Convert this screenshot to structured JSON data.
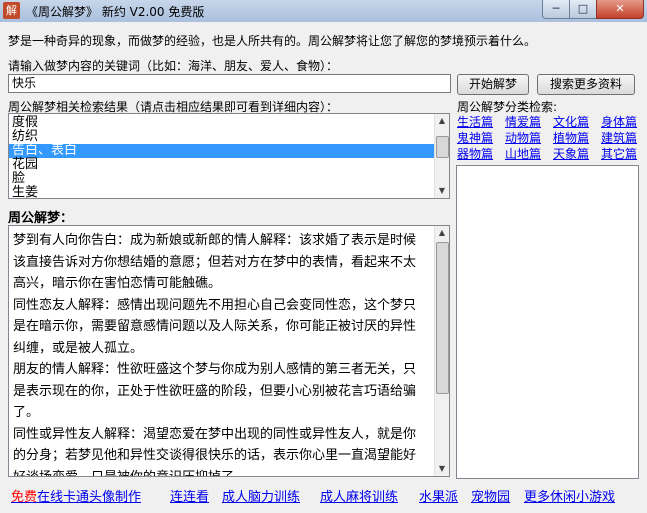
{
  "window": {
    "icon_char": "解",
    "title": "《周公解梦》 新约 V2.00 免费版",
    "controls": {
      "minimize": "─",
      "maximize": "□",
      "close": "✕"
    }
  },
  "intro": "梦是一种奇异的现象，而做梦的经验，也是人所共有的。周公解梦将让您了解您的梦境预示着什么。",
  "search": {
    "prompt": "请输入做梦内容的关键词（比如：海洋、朋友、爱人、食物）：",
    "value": "快乐",
    "start_button": "开始解梦",
    "more_button": "搜索更多资料"
  },
  "results": {
    "label": "周公解梦相关检索结果（请点击相应结果即可看到详细内容）：",
    "items": [
      "度假",
      "纺织",
      "告白、表白",
      "花园",
      "脸",
      "生姜"
    ],
    "selected_index": 2
  },
  "categories": {
    "label": "周公解梦分类检索:",
    "items": [
      "生活篇",
      "情爱篇",
      "文化篇",
      "身体篇",
      "鬼神篇",
      "动物篇",
      "植物篇",
      "建筑篇",
      "器物篇",
      "山地篇",
      "天象篇",
      "其它篇"
    ]
  },
  "interpretation": {
    "heading": "周公解梦：",
    "text": "梦到有人向你告白：成为新娘或新郎的情人解释：该求婚了表示是时候该直接告诉对方你想结婚的意愿；但若对方在梦中的表情，看起来不太高兴，暗示你在害怕恋情可能触礁。\n同性恋友人解释：感情出现问题先不用担心自己会变同性恋，这个梦只是在暗示你，需要留意感情问题以及人际关系，你可能正被讨厌的异性纠缠，或是被人孤立。\n朋友的情人解释：性欲旺盛这个梦与你成为别人感情的第三者无关，只是表示现在的你，正处于性欲旺盛的阶段，但要小心别被花言巧语给骗了。\n同性或异性友人解释：渴望恋爱在梦中出现的同性或异性友人，就是你的分身；若梦见他和异性交谈得很快乐的话，表示你心里一直渴望能好好谈场恋爱，只是被你的意识压抑掉了。"
  },
  "footer": {
    "links": [
      {
        "prefix": "免费",
        "label": "在线卡通头像制作"
      },
      {
        "prefix": "",
        "label": "连连看"
      },
      {
        "prefix": "",
        "label": "成人脑力训练"
      },
      {
        "prefix": "",
        "label": "成人麻将训练"
      },
      {
        "prefix": "",
        "label": "水果派"
      },
      {
        "prefix": "",
        "label": "宠物园"
      },
      {
        "prefix": "",
        "label": "更多休闲小游戏"
      }
    ]
  },
  "colors": {
    "link": "#0000ee",
    "selection": "#3399ff",
    "free_prefix": "#ff0000"
  }
}
